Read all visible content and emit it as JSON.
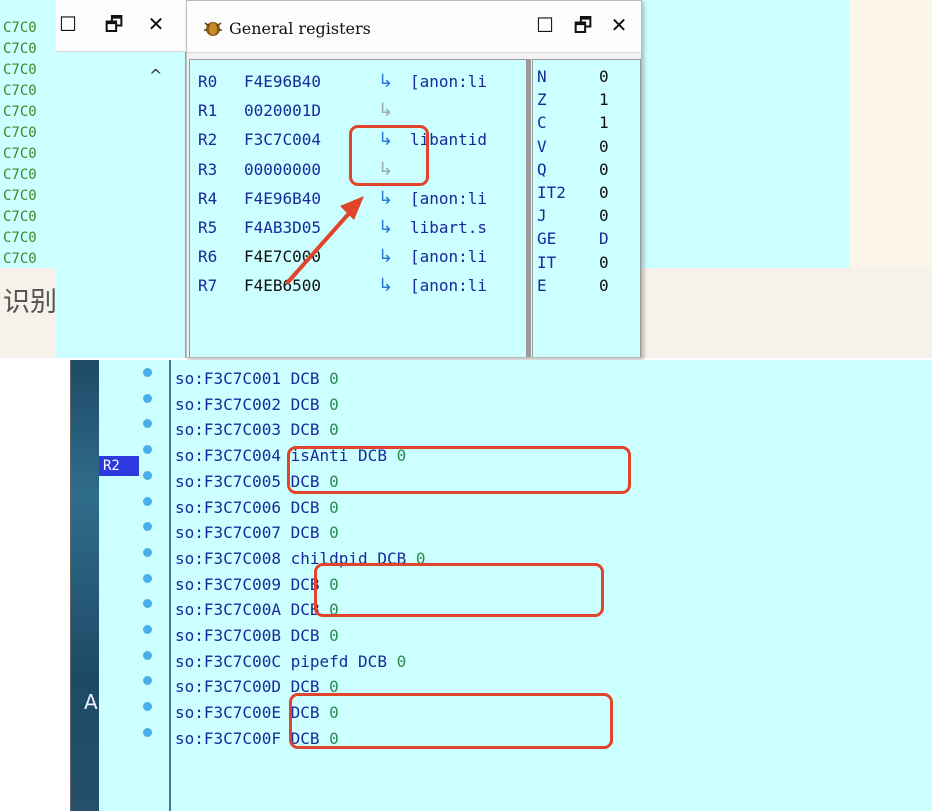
{
  "left_window": {
    "address_rows": [
      "C7C0",
      "C7C0",
      "C7C0",
      "C7C0",
      "C7C0",
      "C7C0",
      "C7C0",
      "C7C0",
      "C7C0",
      "C7C0",
      "C7C0",
      "C7C0"
    ],
    "cn_text": "识别"
  },
  "registers_window": {
    "title": "General registers",
    "registers": [
      {
        "name": "R0",
        "value": "F4E96B40",
        "arrow": "↳",
        "desc": "[anon:li"
      },
      {
        "name": "R1",
        "value": "0020001D",
        "arrow": "↳",
        "desc": ""
      },
      {
        "name": "R2",
        "value": "F3C7C004",
        "arrow": "↳",
        "desc": "libantid"
      },
      {
        "name": "R3",
        "value": "00000000",
        "arrow": "↳",
        "desc": ""
      },
      {
        "name": "R4",
        "value": "F4E96B40",
        "arrow": "↳",
        "desc": "[anon:li"
      },
      {
        "name": "R5",
        "value": "F4AB3D05",
        "arrow": "↳",
        "desc": "libart.s"
      },
      {
        "name": "R6",
        "value": "F4E7C000",
        "arrow": "↳",
        "desc": "[anon:li"
      },
      {
        "name": "R7",
        "value": "F4EB6500",
        "arrow": "↳",
        "desc": "[anon:li"
      }
    ],
    "flags": [
      {
        "name": "N",
        "value": "0"
      },
      {
        "name": "Z",
        "value": "1"
      },
      {
        "name": "C",
        "value": "1"
      },
      {
        "name": "V",
        "value": "0"
      },
      {
        "name": "Q",
        "value": "0"
      },
      {
        "name": "IT2",
        "value": "0"
      },
      {
        "name": "J",
        "value": "0"
      },
      {
        "name": "GE",
        "value": "D"
      },
      {
        "name": "IT",
        "value": "0"
      },
      {
        "name": "E",
        "value": "0"
      }
    ]
  },
  "disassembly": {
    "marker_label": "R2",
    "side_char": "A",
    "rows": [
      {
        "addr": "so:F3C7C001",
        "label": "",
        "op": "DCB",
        "val": "0"
      },
      {
        "addr": "so:F3C7C002",
        "label": "",
        "op": "DCB",
        "val": "0"
      },
      {
        "addr": "so:F3C7C003",
        "label": "",
        "op": "DCB",
        "val": "0"
      },
      {
        "addr": "so:F3C7C004",
        "label": "isAnti",
        "op": "DCB",
        "val": "0"
      },
      {
        "addr": "so:F3C7C005",
        "label": "",
        "op": "DCB",
        "val": "0"
      },
      {
        "addr": "so:F3C7C006",
        "label": "",
        "op": "DCB",
        "val": "0"
      },
      {
        "addr": "so:F3C7C007",
        "label": "",
        "op": "DCB",
        "val": "0"
      },
      {
        "addr": "so:F3C7C008",
        "label": "childpid",
        "op": "DCB",
        "val": "0"
      },
      {
        "addr": "so:F3C7C009",
        "label": "",
        "op": "DCB",
        "val": "0"
      },
      {
        "addr": "so:F3C7C00A",
        "label": "",
        "op": "DCB",
        "val": "0"
      },
      {
        "addr": "so:F3C7C00B",
        "label": "",
        "op": "DCB",
        "val": "0"
      },
      {
        "addr": "so:F3C7C00C",
        "label": "pipefd",
        "op": "DCB",
        "val": "0"
      },
      {
        "addr": "so:F3C7C00D",
        "label": "",
        "op": "DCB",
        "val": "0"
      },
      {
        "addr": "so:F3C7C00E",
        "label": "",
        "op": "DCB",
        "val": "0"
      },
      {
        "addr": "so:F3C7C00F",
        "label": "",
        "op": "DCB",
        "val": "0"
      }
    ]
  },
  "colors": {
    "pane_bg": "#ccffff",
    "highlight": "#e0442a",
    "text_blue": "#1a2a9a",
    "number_green": "#2c8c4c"
  }
}
